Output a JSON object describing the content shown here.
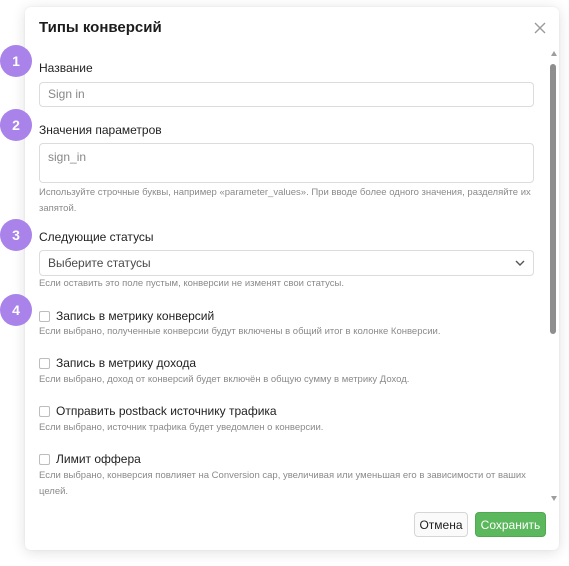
{
  "modal": {
    "title": "Типы конверсий",
    "close_icon": "close-icon"
  },
  "fields": {
    "name": {
      "label": "Название",
      "value": "Sign in"
    },
    "params": {
      "label": "Значения параметров",
      "value": "sign_in",
      "help": "Используйте строчные буквы, например «parameter_values». При вводе более одного значения, разделяйте их запятой."
    },
    "statuses": {
      "label": "Следующие статусы",
      "placeholder": "Выберите статусы",
      "help": "Если оставить это поле пустым, конверсии не изменят свои статусы."
    }
  },
  "checkboxes": [
    {
      "label": "Запись в метрику конверсий",
      "help": "Если выбрано, полученные конверсии будут включены в общий итог в колонке Конверсии.",
      "checked": false
    },
    {
      "label": "Запись в метрику дохода",
      "help": "Если выбрано, доход от конверсий будет включён в общую сумму в метрику Доход.",
      "checked": false
    },
    {
      "label": "Отправить postback источнику трафика",
      "help": "Если выбрано, источник трафика будет уведомлен о конверсии.",
      "checked": false
    },
    {
      "label": "Лимит оффера",
      "help": "Если выбрано, конверсия повлияет на Conversion cap, увеличивая или уменьшая его в зависимости от ваших целей.",
      "checked": false
    }
  ],
  "footer": {
    "cancel_label": "Отмена",
    "save_label": "Сохранить"
  },
  "steps": [
    "1",
    "2",
    "3",
    "4"
  ],
  "colors": {
    "step_badge": "#a982ea",
    "save_button": "#5cb85c"
  }
}
